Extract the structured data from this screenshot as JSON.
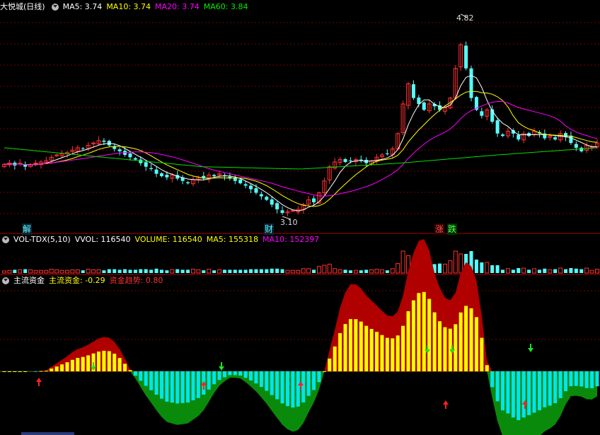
{
  "main": {
    "stock_title": "大悦城(日线)",
    "ma5": "MA5: 3.74",
    "ma10": "MA10: 3.74",
    "ma20": "MA20: 3.74",
    "ma60": "MA60: 3.84",
    "high_label": "4.82",
    "low_label": "3.10",
    "tag_jie": "解",
    "tag_cai": "财",
    "tag_zhang": "涨",
    "tag_die": "跌"
  },
  "volume": {
    "indicator": "VOL-TDX(5,10)",
    "vvol": "VVOL: 116540",
    "volume": "VOLUME: 116540",
    "ma5": "MA5: 155318",
    "ma10": "MA10: 152397"
  },
  "fund": {
    "indicator": "主流资金",
    "main_fund": "主流资金: -0.29",
    "trend": "资金趋势: 0.80"
  },
  "colors": {
    "up": "#ff3232",
    "down": "#54ffff",
    "ma5": "#ffffff",
    "ma10": "#ffff00",
    "ma20": "#ff00ff",
    "ma60": "#00e000",
    "grid": "#7a0000"
  },
  "chart_data": {
    "type": "candlestick",
    "price_min": 3.1,
    "price_max": 4.82,
    "closes": [
      3.54,
      3.55,
      3.53,
      3.55,
      3.52,
      3.54,
      3.55,
      3.56,
      3.57,
      3.6,
      3.62,
      3.63,
      3.64,
      3.66,
      3.68,
      3.67,
      3.7,
      3.72,
      3.74,
      3.73,
      3.7,
      3.67,
      3.65,
      3.62,
      3.6,
      3.58,
      3.55,
      3.52,
      3.5,
      3.46,
      3.44,
      3.43,
      3.45,
      3.42,
      3.4,
      3.38,
      3.41,
      3.43,
      3.42,
      3.45,
      3.44,
      3.46,
      3.44,
      3.42,
      3.4,
      3.38,
      3.36,
      3.33,
      3.3,
      3.27,
      3.24,
      3.2,
      3.16,
      3.13,
      3.14,
      3.15,
      3.16,
      3.2,
      3.24,
      3.22,
      3.3,
      3.4,
      3.52,
      3.56,
      3.58,
      3.56,
      3.57,
      3.58,
      3.57,
      3.55,
      3.57,
      3.6,
      3.62,
      3.63,
      3.67,
      3.8,
      4.05,
      4.22,
      4.1,
      4.05,
      4.0,
      4.05,
      4.03,
      4.0,
      4.02,
      4.1,
      4.35,
      4.55,
      4.35,
      4.1,
      4.0,
      3.95,
      4.0,
      3.9,
      3.8,
      3.78,
      3.82,
      3.8,
      3.75,
      3.8,
      3.78,
      3.82,
      3.8,
      3.76,
      3.78,
      3.75,
      3.8,
      3.77,
      3.72,
      3.68,
      3.65,
      3.7,
      3.69,
      3.72
    ]
  }
}
